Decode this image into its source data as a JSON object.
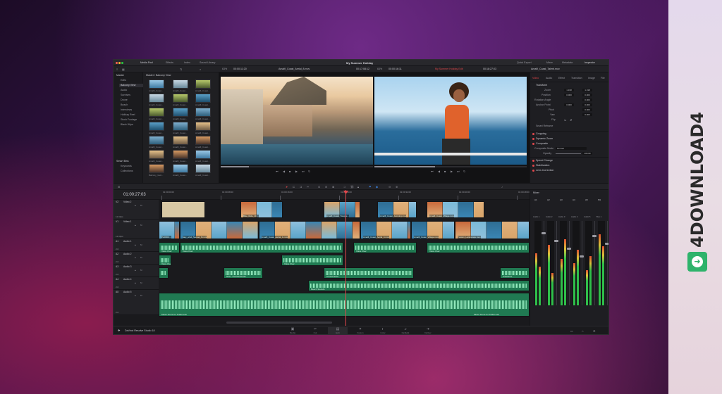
{
  "app": {
    "project_title": "My Summer Holiday",
    "product_name": "DaVinci Resolve Studio 18"
  },
  "menubar": {
    "items": [
      "Media Pool",
      "Effects",
      "Index",
      "Sound Library"
    ],
    "right_items": [
      "Quick Export",
      "Mixer",
      "Metadata",
      "Inspector"
    ]
  },
  "toolbar": {
    "source_zoom": "63%",
    "source_timecode": "00:00:11:20",
    "source_clip": "Amalfi_Coast_Aerial_8.mov",
    "source_duration": "00:17:08:12",
    "program_zoom": "63%",
    "program_timecode": "00:00:16:11",
    "program_timeline": "My Summer Holiday Edit",
    "program_position": "00:18:27:03",
    "inspector_clip": "Amalfi_Coast_Talent.mov"
  },
  "media_pool": {
    "bins_header": "Master",
    "bins": [
      "Edits",
      "Balcony View",
      "Audio",
      "Sunrises",
      "Drone",
      "Beach",
      "Interviews",
      "Holiday Reel",
      "Stock Footage",
      "Black Wipe"
    ],
    "smart_bins_header": "Smart Bins",
    "smart_bins": [
      "Keywords",
      "Collections"
    ],
    "current_path": "Master / Balcony View",
    "clip_labels": [
      "Amalfi_Coast...",
      "Amalfi_Coast...",
      "Amalfi_Coast...",
      "Amalfi_Coast...",
      "Amalfi_Coast...",
      "Amalfi_Coast...",
      "Amalfi_Coast...",
      "Amalfi_Coast...",
      "Amalfi_Coast...",
      "Amalfi_Coast...",
      "Amalfi_Coast...",
      "Amalfi_Coast...",
      "Amalfi_Coast...",
      "Amalfi_Coast...",
      "Amalfi_Coast...",
      "Amalfi_Coast...",
      "Amalfi_Coast...",
      "Amalfi_Coast...",
      "Balcony_Guit...",
      "Amalfi_Coast...",
      "Amalfi_Coast..."
    ]
  },
  "inspector": {
    "tabs": [
      "Video",
      "Audio",
      "Effect",
      "Transition",
      "Image",
      "File"
    ],
    "section_transform": "Transform",
    "zoom_label": "Zoom",
    "zoom_x": "1.198",
    "zoom_y": "1.198",
    "position_label": "Position",
    "position_x": "0.000",
    "position_y": "0.000",
    "rotation_label": "Rotation Angle",
    "rotation": "0.000",
    "anchor_label": "Anchor Point",
    "anchor_x": "0.000",
    "anchor_y": "0.000",
    "pitch_label": "Pitch",
    "pitch": "0.000",
    "yaw_label": "Yaw",
    "yaw": "0.000",
    "flip_label": "Flip",
    "smart_reframe": "Smart Reframe",
    "cropping": "Cropping",
    "dynamic_zoom": "Dynamic Zoom",
    "composite": "Composite",
    "composite_mode_label": "Composite Mode",
    "composite_mode": "Normal",
    "opacity_label": "Opacity",
    "opacity": "100.00",
    "speed_change": "Speed Change",
    "stabilization": "Stabilization",
    "lens_correction": "Lens Correction"
  },
  "timeline": {
    "timecode": "01:00:27:03",
    "ruler_marks": [
      "01:00:00:00",
      "01:00:08:00",
      "01:00:16:00",
      "01:00:24:00",
      "01:00:32:00",
      "01:00:40:00",
      "01:00:48:00"
    ],
    "tracks": [
      {
        "id": "V2",
        "name": "Video 2",
        "clips_count": "11 Clips"
      },
      {
        "id": "V1",
        "name": "Video 1",
        "clips_count": "11 Clips"
      },
      {
        "id": "A1",
        "name": "Audio 1",
        "clips_count": "2.0"
      },
      {
        "id": "A2",
        "name": "Audio 2",
        "clips_count": "2.0"
      },
      {
        "id": "A3",
        "name": "Audio 3",
        "clips_count": "2.0"
      },
      {
        "id": "A4",
        "name": "Audio 4",
        "clips_count": "2.0"
      },
      {
        "id": "A5",
        "name": "Audio 5",
        "clips_count": "2.0"
      }
    ],
    "clip_names": {
      "v2_a": "Bike_Ride_Ch...",
      "v2_b": "Amalfi_Coast_Tongue...",
      "v2_c": "Amalfi_Coast_Jumping.mov",
      "v2_d": "Amalfi_Coast_Village.mov",
      "v1_a": "Pol0004...",
      "v1_b": "Italy_wind_Sunset_8.mov",
      "v1_c": "Amalfi_Coast_Aerial_1.mov",
      "v1_d": "Amalfi_Coast_Aerial_4.mov",
      "v1_e": "Amalfi_Coast_Village.mov",
      "v1_f": "Tuscan_Landscape.mov",
      "a1_a": "Voice Over",
      "a1_b": "Voice Over",
      "a1_c": "Voice Over",
      "a1_d": "Voice Over",
      "a2_a": "Voice Over",
      "a2_b": "Voice Over",
      "a3_a": "SFX - Overhead.wav",
      "a3_b": "Crowd Noise",
      "a3_c": "Ambience",
      "a4_a": "Beach Sounds",
      "a5_a": "Music Score for Trailer.wav",
      "a5_b": "Music Score for Trailer.wav"
    }
  },
  "mixer": {
    "title": "Mixer",
    "channels": [
      "A1",
      "A2",
      "A3",
      "A4",
      "A5",
      "M1"
    ],
    "channel_labels": [
      "Audio 1",
      "Audio 2",
      "Audio 3",
      "Audio 4",
      "Audio 5",
      "Bus 1"
    ],
    "levels": [
      0.62,
      0.46,
      0.72,
      0.38,
      0.55,
      0.78,
      0.5,
      0.66,
      0.42,
      0.58,
      0.84,
      0.7
    ]
  },
  "pages": [
    "Media",
    "Cut",
    "Edit",
    "Fusion",
    "Color",
    "Fairlight",
    "Deliver"
  ],
  "active_page": "Edit",
  "brand": {
    "site_name": "4DOWNLOAD4"
  }
}
